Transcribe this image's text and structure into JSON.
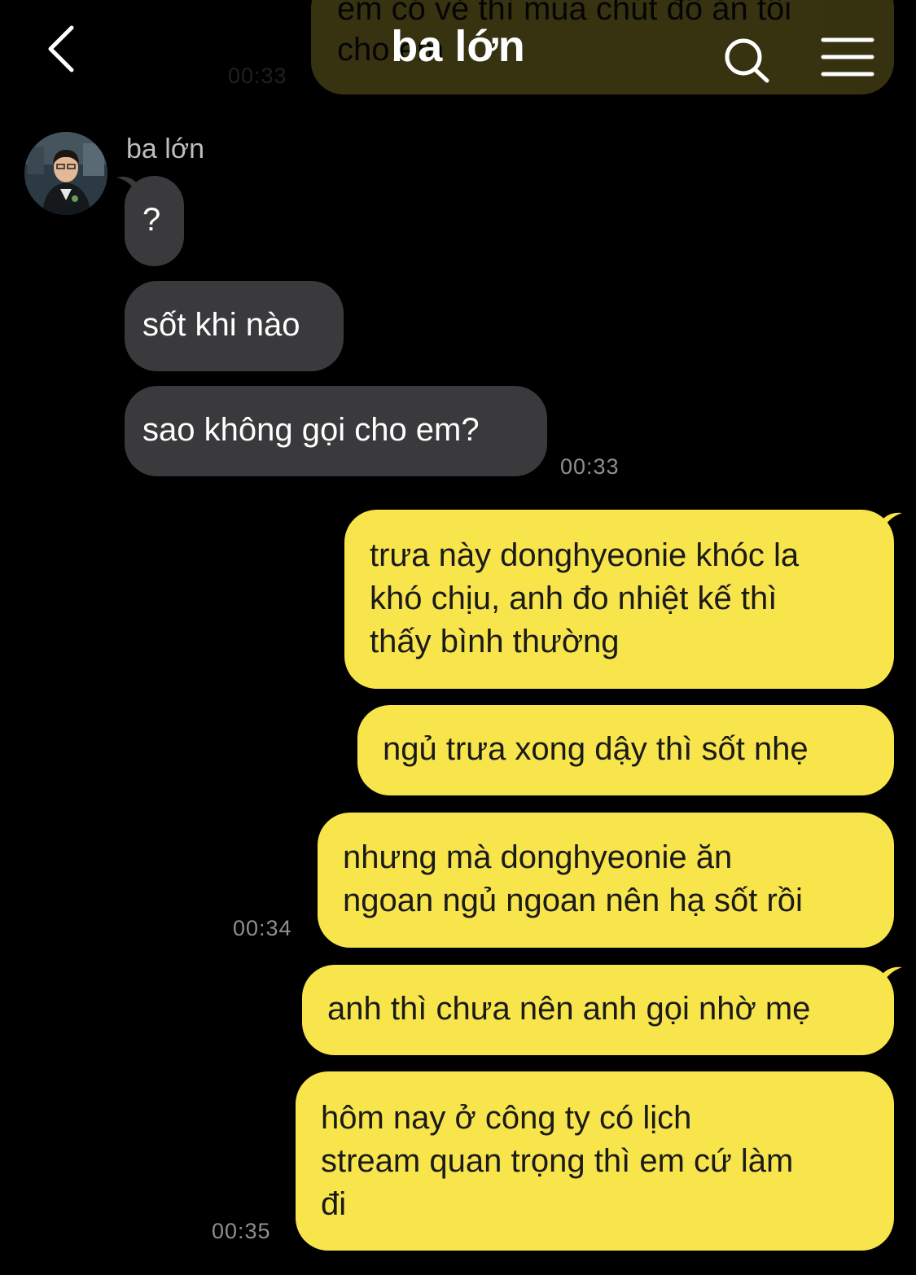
{
  "header": {
    "title": "ba lớn"
  },
  "top_partial": {
    "text_line1": "em có vẻ thì mua chút đồ ăn tối",
    "text_line2": "cho em",
    "time": "00:33"
  },
  "sender": {
    "name": "ba lớn"
  },
  "messages": [
    {
      "text": "?"
    },
    {
      "text": "sốt khi nào"
    },
    {
      "text": "sao không gọi cho em?",
      "time": "00:33"
    },
    {
      "lines": [
        "trưa này donghyeonie khóc la",
        "khó chịu, anh đo nhiệt kế thì",
        "thấy bình thường"
      ]
    },
    {
      "text": "ngủ trưa xong dậy thì sốt nhẹ"
    },
    {
      "lines": [
        "nhưng mà donghyeonie ăn",
        "ngoan ngủ ngoan nên hạ sốt rồi"
      ],
      "time": "00:34"
    },
    {
      "text": "anh thì chưa nên anh gọi nhờ mẹ"
    },
    {
      "lines": [
        "hôm nay ở công ty có lịch",
        "stream quan trọng thì em cứ làm",
        "đi"
      ],
      "time": "00:35"
    }
  ],
  "colors": {
    "background": "#000000",
    "incoming_bubble": "#3a3a3c",
    "outgoing_bubble": "#f8e44b",
    "timestamp": "#8e8e93"
  },
  "icons": [
    "back-chevron-icon",
    "search-icon",
    "menu-icon"
  ]
}
